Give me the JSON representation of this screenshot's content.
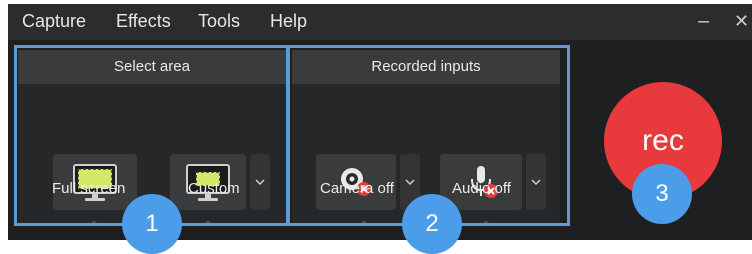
{
  "menu": {
    "capture": "Capture",
    "effects": "Effects",
    "tools": "Tools",
    "help": "Help",
    "minimize": "–",
    "close": "✕"
  },
  "select_area": {
    "title": "Select area",
    "full_screen": "Full screen",
    "custom": "Custom"
  },
  "recorded_inputs": {
    "title": "Recorded inputs",
    "camera": "Camera off",
    "audio": "Audio off"
  },
  "rec_label": "rec",
  "badges": [
    "1",
    "2",
    "3"
  ],
  "colors": {
    "highlight": "#5d9ad6",
    "badge": "#4b9ce9",
    "rec": "#e8393c",
    "off_indicator": "#e03a3a",
    "screen_fill": "#d4e86a"
  }
}
